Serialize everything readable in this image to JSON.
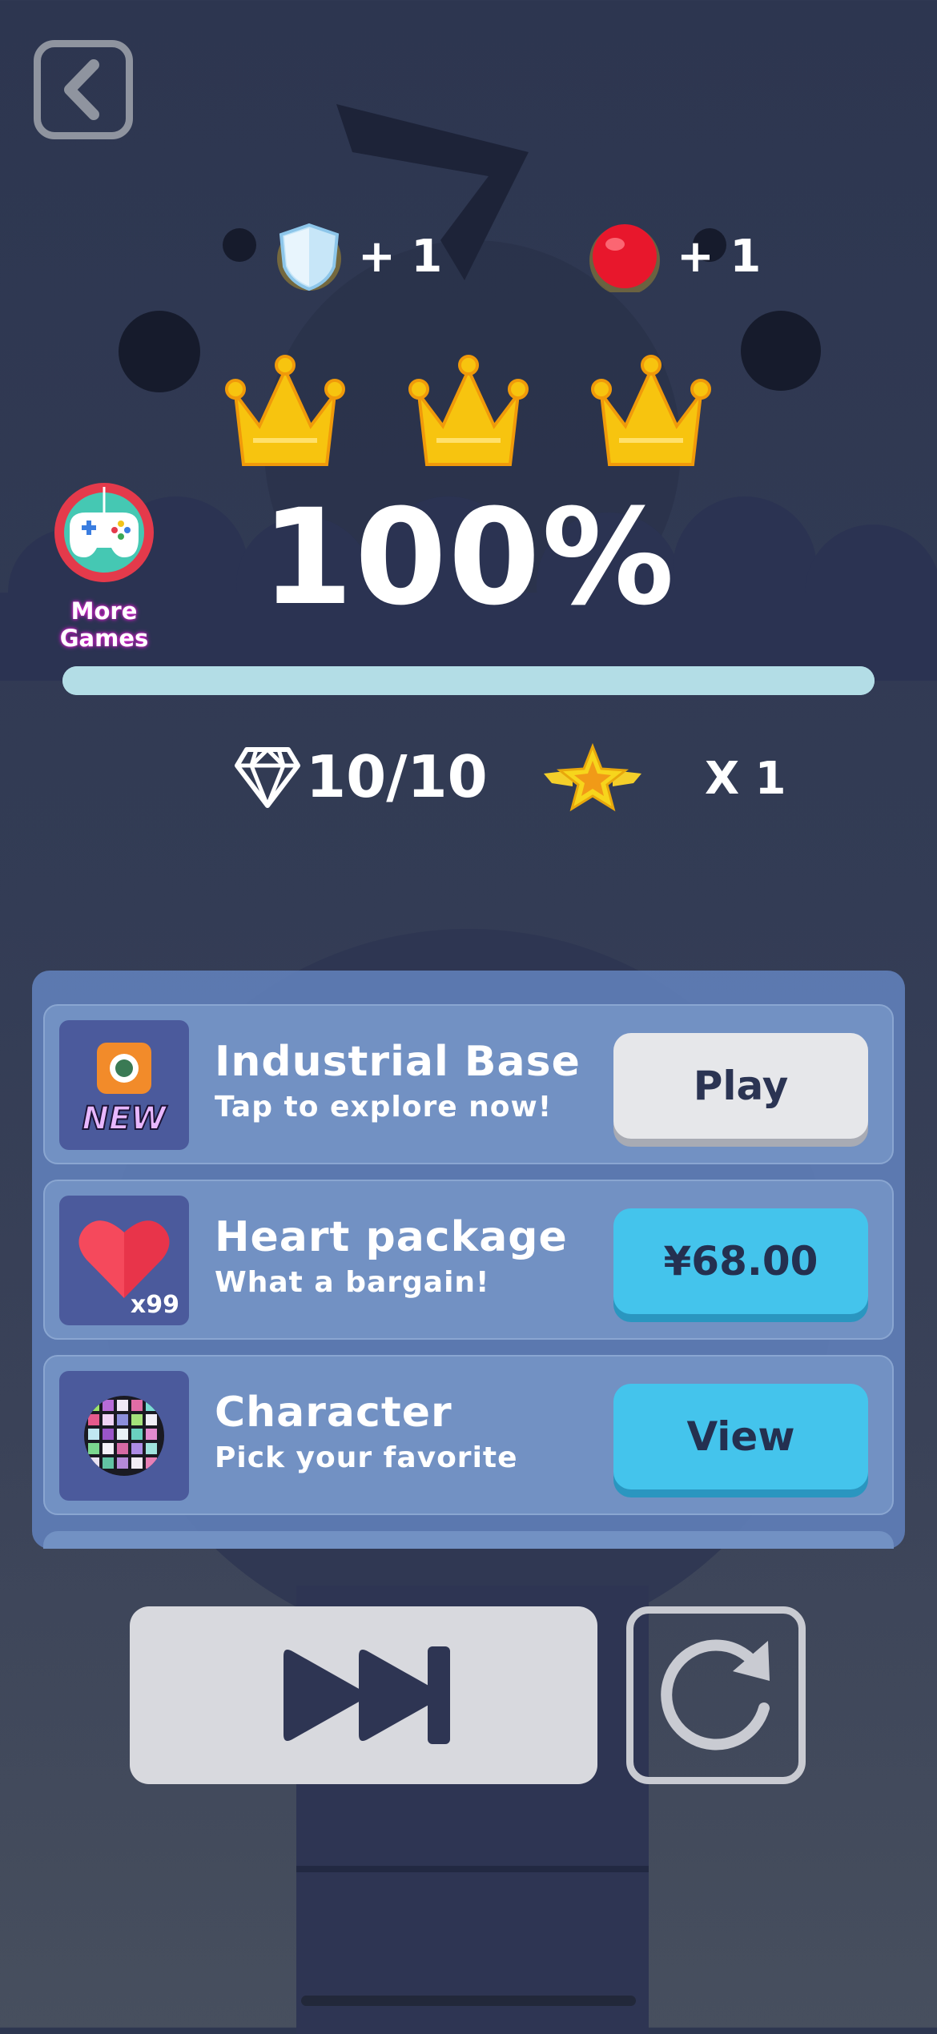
{
  "rewards": [
    {
      "icon": "shield-icon",
      "amount": "+ 1"
    },
    {
      "icon": "red-ball-icon",
      "amount": "+ 1"
    }
  ],
  "crowns": {
    "earned": 3,
    "total": 3
  },
  "progress": {
    "percent_text": "100%",
    "fraction": 1.0
  },
  "more_games": {
    "label": "More Games"
  },
  "stats": {
    "gems": "10/10",
    "multiplier": "X 1"
  },
  "offers": [
    {
      "title": "Industrial Base",
      "subtitle": "Tap to explore now!",
      "button": "Play",
      "badge": "NEW",
      "icon": "industrial-base-icon"
    },
    {
      "title": "Heart package",
      "subtitle": "What a bargain!",
      "button": "¥68.00",
      "count": "x99",
      "icon": "heart-icon"
    },
    {
      "title": "Character",
      "subtitle": "Pick your favorite",
      "button": "View",
      "icon": "disco-ball-icon"
    }
  ],
  "colors": {
    "accent_blue": "#44c4ec",
    "gold": "#f7c40f",
    "progress": "#b3dde6",
    "panel": "#5f7eb7"
  }
}
